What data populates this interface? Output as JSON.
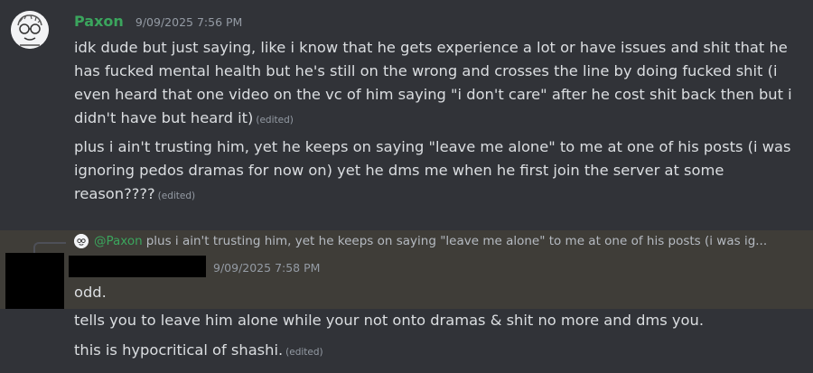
{
  "message1": {
    "username": "Paxon",
    "timestamp": "9/09/2025 7:56 PM",
    "paragraph1": "idk dude but just saying, like i know that he gets experience a lot or have issues and shit that he has fucked mental health but he's still on the wrong and crosses the line by doing fucked shit (i even heard that one video on the vc of him saying \"i don't care\" after he cost shit back then but i didn't have but heard it)",
    "paragraph2": "plus i ain't trusting him, yet he keeps on saying \"leave me alone\" to me at one of his posts (i was ignoring pedos dramas for now on) yet he dms me when he first join the server at some reason????",
    "edited_label": "(edited)"
  },
  "message2": {
    "reply_mention": "@Paxon",
    "reply_preview": "plus i ain't trusting him, yet he keeps on saying \"leave me alone\" to me at one of his posts (i was ig...",
    "timestamp": "9/09/2025 7:58 PM",
    "line1": "odd.",
    "line2": "tells you to leave him  alone while your not onto dramas & shit no more and dms you.",
    "line3": "this is hypocritical of shashi.",
    "edited_label": "(edited)"
  },
  "colors": {
    "background": "#313338",
    "highlight": "#3f3d38",
    "username": "#3ba55d",
    "text": "#dbdee1",
    "muted": "#949ba4"
  },
  "icons": {
    "avatar": "cartoon-face-avatar",
    "reply_avatar": "cartoon-face-avatar-small"
  }
}
